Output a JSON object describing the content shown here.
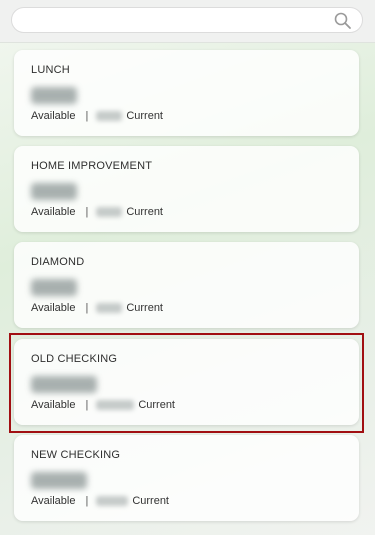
{
  "search": {
    "placeholder": "",
    "icon": "search-icon"
  },
  "accounts": [
    {
      "name": "LUNCH",
      "available_label": "Available",
      "separator": "|",
      "current_label": "Current",
      "amount_obscured": true
    },
    {
      "name": "HOME IMPROVEMENT",
      "available_label": "Available",
      "separator": "|",
      "current_label": "Current",
      "amount_obscured": true
    },
    {
      "name": "DIAMOND",
      "available_label": "Available",
      "separator": "|",
      "current_label": "Current",
      "amount_obscured": true
    },
    {
      "name": "OLD CHECKING",
      "available_label": "Available",
      "separator": "|",
      "current_label": "Current",
      "amount_obscured": true,
      "highlighted": true
    },
    {
      "name": "NEW CHECKING",
      "available_label": "Available",
      "separator": "|",
      "current_label": "Current",
      "amount_obscured": true
    }
  ],
  "colors": {
    "highlight_border": "#a10f12",
    "card_background": "#ffffff",
    "page_background": "#e2eedd"
  }
}
